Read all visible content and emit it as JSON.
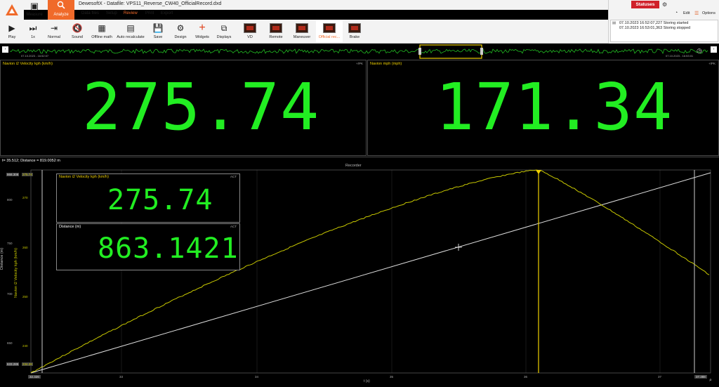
{
  "window": {
    "title": "DewesoftX - Datafile: VPS11_Reverse_CW40_OfficialRecord.dxd",
    "controls": {
      "minimize": "—",
      "maximize": "❐",
      "close": "✕"
    }
  },
  "modes": {
    "measure": "Measure",
    "analyze": "Analyze"
  },
  "menu": {
    "data_files": "Data files",
    "setup": "Setup",
    "review": "Review",
    "print": "Print",
    "export": "Export"
  },
  "ribbon": {
    "play": "Play",
    "speed": "1x",
    "normal": "Normal",
    "sound": "Sound",
    "offline_math": "Offline math",
    "auto_recalculate": "Auto recalculate",
    "save": "Save",
    "design": "Design",
    "widgets": "Widgets",
    "displays": "Displays",
    "screens": [
      "VD",
      "Remote",
      "Maneuver",
      "Official rec...",
      "Brake"
    ]
  },
  "side": {
    "statuses": "Statuses",
    "edit": "Edit",
    "options": "Options",
    "log": [
      "07.10.2023 16:52:07,227 Storing started",
      "07.10.2023 16:53:01,363 Storing stopped"
    ]
  },
  "overview": {
    "start_time": "07.10.2023 - 16:52:07",
    "end_time": "07.10.2023 - 16:53:01",
    "colors": {
      "trace": "#22bb22",
      "selection": "#f0d000"
    }
  },
  "digital_meters": [
    {
      "title": "Navion i2 Velocity kph (km/h)",
      "tag": "+/PK",
      "value": "275.74"
    },
    {
      "title": "Navion mph (mph)",
      "tag": "+/PK",
      "value": "171.34"
    }
  ],
  "recorder": {
    "cursor_info": "t= 35.512; Distance = 819.0052 m",
    "title": "Recorder",
    "x_axis_label": "t (s)",
    "x_ticks": [
      "33",
      "34",
      "35",
      "36",
      "37"
    ],
    "x_start": "32.326",
    "x_end": "37.388",
    "y_left_label": "Distance (m)",
    "y_left_ticks": [
      "800",
      "750",
      "700",
      "650"
    ],
    "y_left_top": "868.308",
    "y_left_bottom": "633.285",
    "y_right_label": "Navion i2 Velocity kph (km/h)",
    "y_right_ticks": [
      "270",
      "260",
      "250",
      "240"
    ],
    "y_right_top": "275.74",
    "y_right_bottom": "234.28",
    "inline_meters": [
      {
        "title": "Navion i2 Velocity kph (km/h)",
        "tag": "ACT",
        "value": "275.74"
      },
      {
        "title": "Distance (m)",
        "tag": "ACT",
        "value": "863.1421"
      }
    ],
    "colors": {
      "velocity": "#c8c800",
      "distance": "#dddddd",
      "cursor": "#f0d000"
    }
  }
}
